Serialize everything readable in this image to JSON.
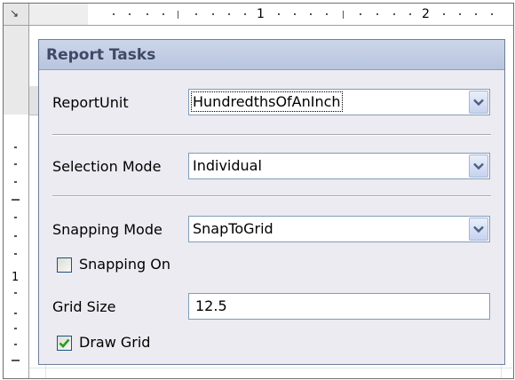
{
  "ruler": {
    "corner_icon": "collapse-arrow-icon",
    "numbers": [
      "1",
      "2"
    ],
    "vertical_numbers": [
      "1"
    ]
  },
  "panel": {
    "title": "Report Tasks",
    "report_unit": {
      "label": "ReportUnit",
      "value": "HundredthsOfAnInch",
      "icon": "chevron-down-icon"
    },
    "selection_mode": {
      "label": "Selection Mode",
      "value": "Individual",
      "icon": "chevron-down-icon"
    },
    "snapping_mode": {
      "label": "Snapping Mode",
      "value": "SnapToGrid",
      "icon": "chevron-down-icon"
    },
    "snapping_on": {
      "label": "Snapping On",
      "checked": false
    },
    "grid_size": {
      "label": "Grid Size",
      "value": "12.5"
    },
    "draw_grid": {
      "label": "Draw Grid",
      "checked": true
    }
  },
  "colors": {
    "panel_bg": "#ecebf1",
    "header_bg": "#c2cee6",
    "title": "#3e4a66",
    "field_border": "#7f9db9",
    "check_mark": "#21a121"
  }
}
